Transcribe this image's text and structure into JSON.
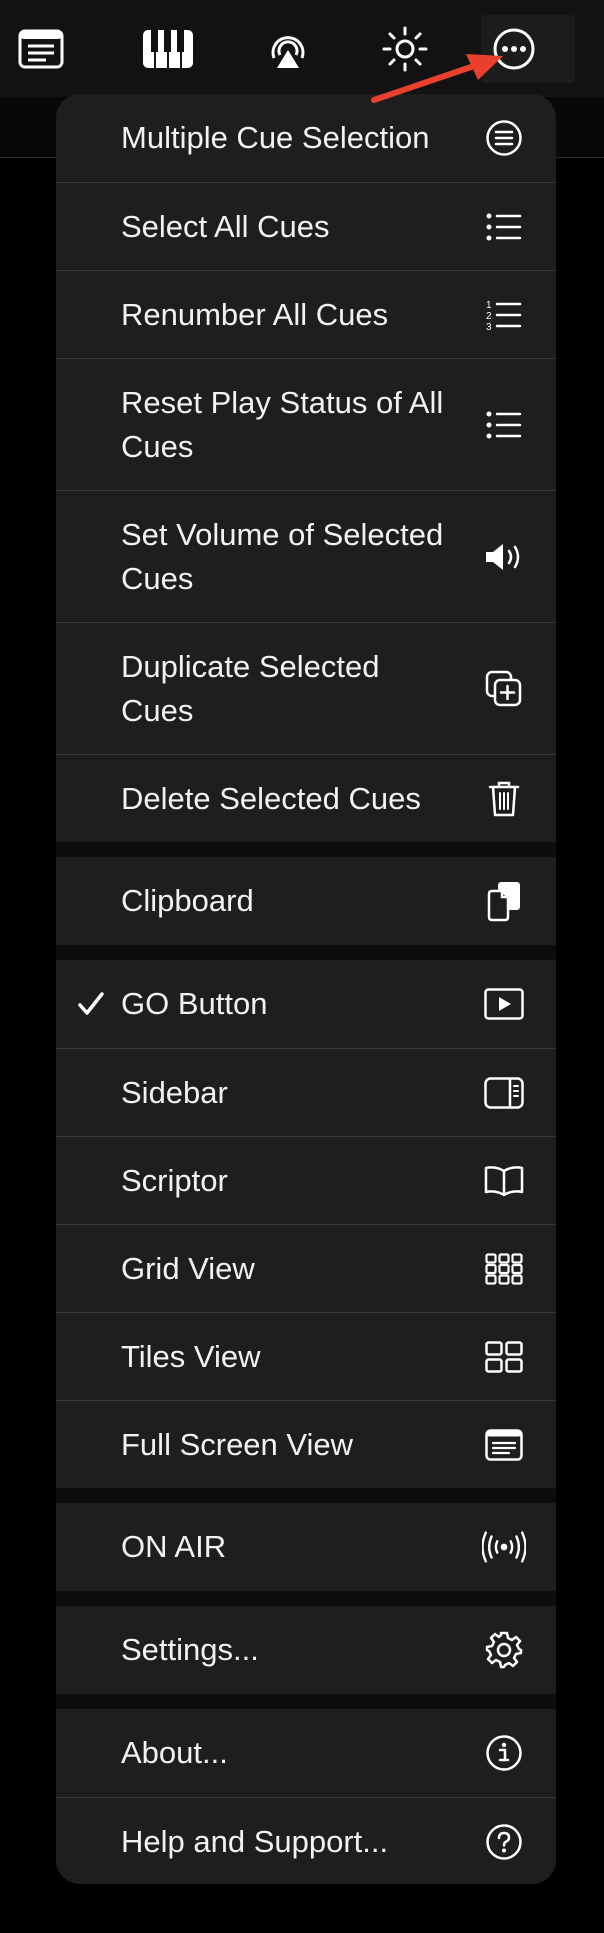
{
  "toolbar": {
    "icons": [
      "document-icon",
      "piano-keys-icon",
      "airplay-icon",
      "brightness-icon",
      "more-icon"
    ]
  },
  "menu": {
    "groups": [
      {
        "items": [
          {
            "label": "Multiple Cue Selection",
            "icon": "list-circle-icon"
          },
          {
            "label": "Select All Cues",
            "icon": "list-bullet-icon"
          },
          {
            "label": "Renumber All Cues",
            "icon": "list-number-icon"
          },
          {
            "label": "Reset Play Status of All Cues",
            "icon": "list-bullet-icon"
          },
          {
            "label": "Set Volume of Selected Cues",
            "icon": "speaker-icon"
          },
          {
            "label": "Duplicate Selected Cues",
            "icon": "duplicate-icon"
          },
          {
            "label": "Delete Selected Cues",
            "icon": "trash-icon"
          }
        ]
      },
      {
        "items": [
          {
            "label": "Clipboard",
            "icon": "clipboard-icon"
          }
        ]
      },
      {
        "items": [
          {
            "label": "GO Button",
            "icon": "play-rectangle-icon",
            "checked": true
          },
          {
            "label": "Sidebar",
            "icon": "sidebar-icon"
          },
          {
            "label": "Scriptor",
            "icon": "book-icon"
          },
          {
            "label": "Grid View",
            "icon": "grid-icon"
          },
          {
            "label": "Tiles View",
            "icon": "tiles-icon"
          },
          {
            "label": "Full Screen View",
            "icon": "fullscreen-doc-icon"
          }
        ]
      },
      {
        "items": [
          {
            "label": "ON AIR",
            "icon": "broadcast-icon"
          }
        ]
      },
      {
        "items": [
          {
            "label": "Settings...",
            "icon": "gear-icon"
          }
        ]
      },
      {
        "items": [
          {
            "label": "About...",
            "icon": "info-icon"
          },
          {
            "label": "Help and Support...",
            "icon": "question-icon"
          }
        ]
      }
    ]
  },
  "colors": {
    "background": "#000000",
    "menu_background": "#1e1e1e",
    "separator": "#3a3a3a",
    "text": "#f2f2f2",
    "annotation_arrow": "#e8402d"
  }
}
